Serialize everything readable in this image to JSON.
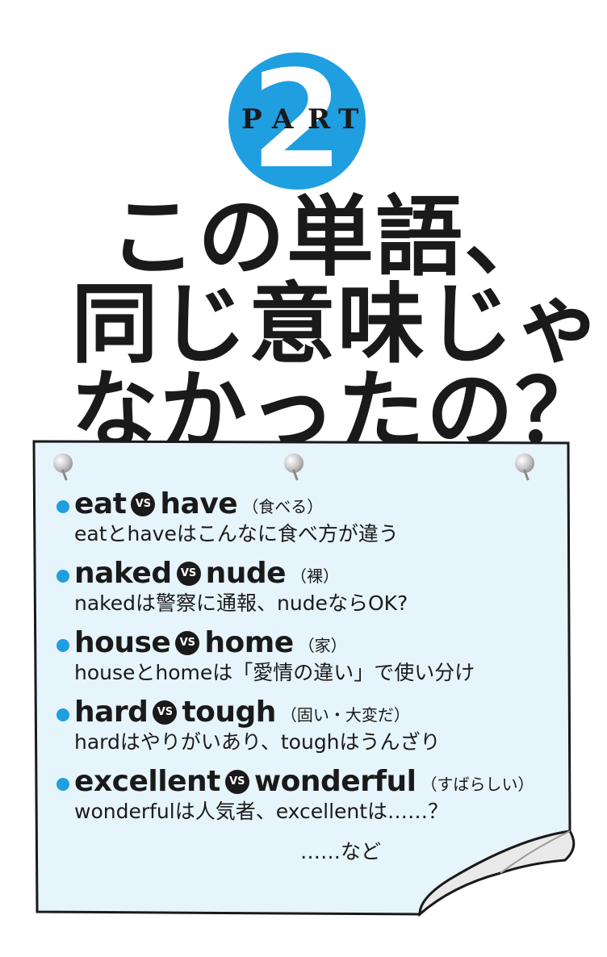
{
  "badge": {
    "part_label": "PART",
    "letters": [
      "P",
      "A",
      "R",
      "T"
    ],
    "number": "2",
    "color": "#1f9ee0"
  },
  "title": {
    "lines": [
      "この単語、",
      "同じ意味じゃ",
      "なかったの？"
    ]
  },
  "note": {
    "paper_color": "#e6f4fb",
    "items": [
      {
        "word1": "eat",
        "vs": "VS",
        "word2": "have",
        "gloss": "（食べる）",
        "desc": "eatとhaveはこんなに食べ方が違う"
      },
      {
        "word1": "naked",
        "vs": "VS",
        "word2": "nude",
        "gloss": "（裸）",
        "desc": "nakedは警察に通報、nudeならOK?"
      },
      {
        "word1": "house",
        "vs": "VS",
        "word2": "home",
        "gloss": "（家）",
        "desc": "houseとhomeは「愛情の違い」で使い分け"
      },
      {
        "word1": "hard",
        "vs": "VS",
        "word2": "tough",
        "gloss": "（固い・大変だ）",
        "desc": "hardはやりがいあり、toughはうんざり"
      },
      {
        "word1": "excellent",
        "vs": "VS",
        "word2": "wonderful",
        "gloss": "（すばらしい）",
        "desc": "wonderfulは人気者、excellentは……？"
      }
    ],
    "etc": "……など"
  }
}
